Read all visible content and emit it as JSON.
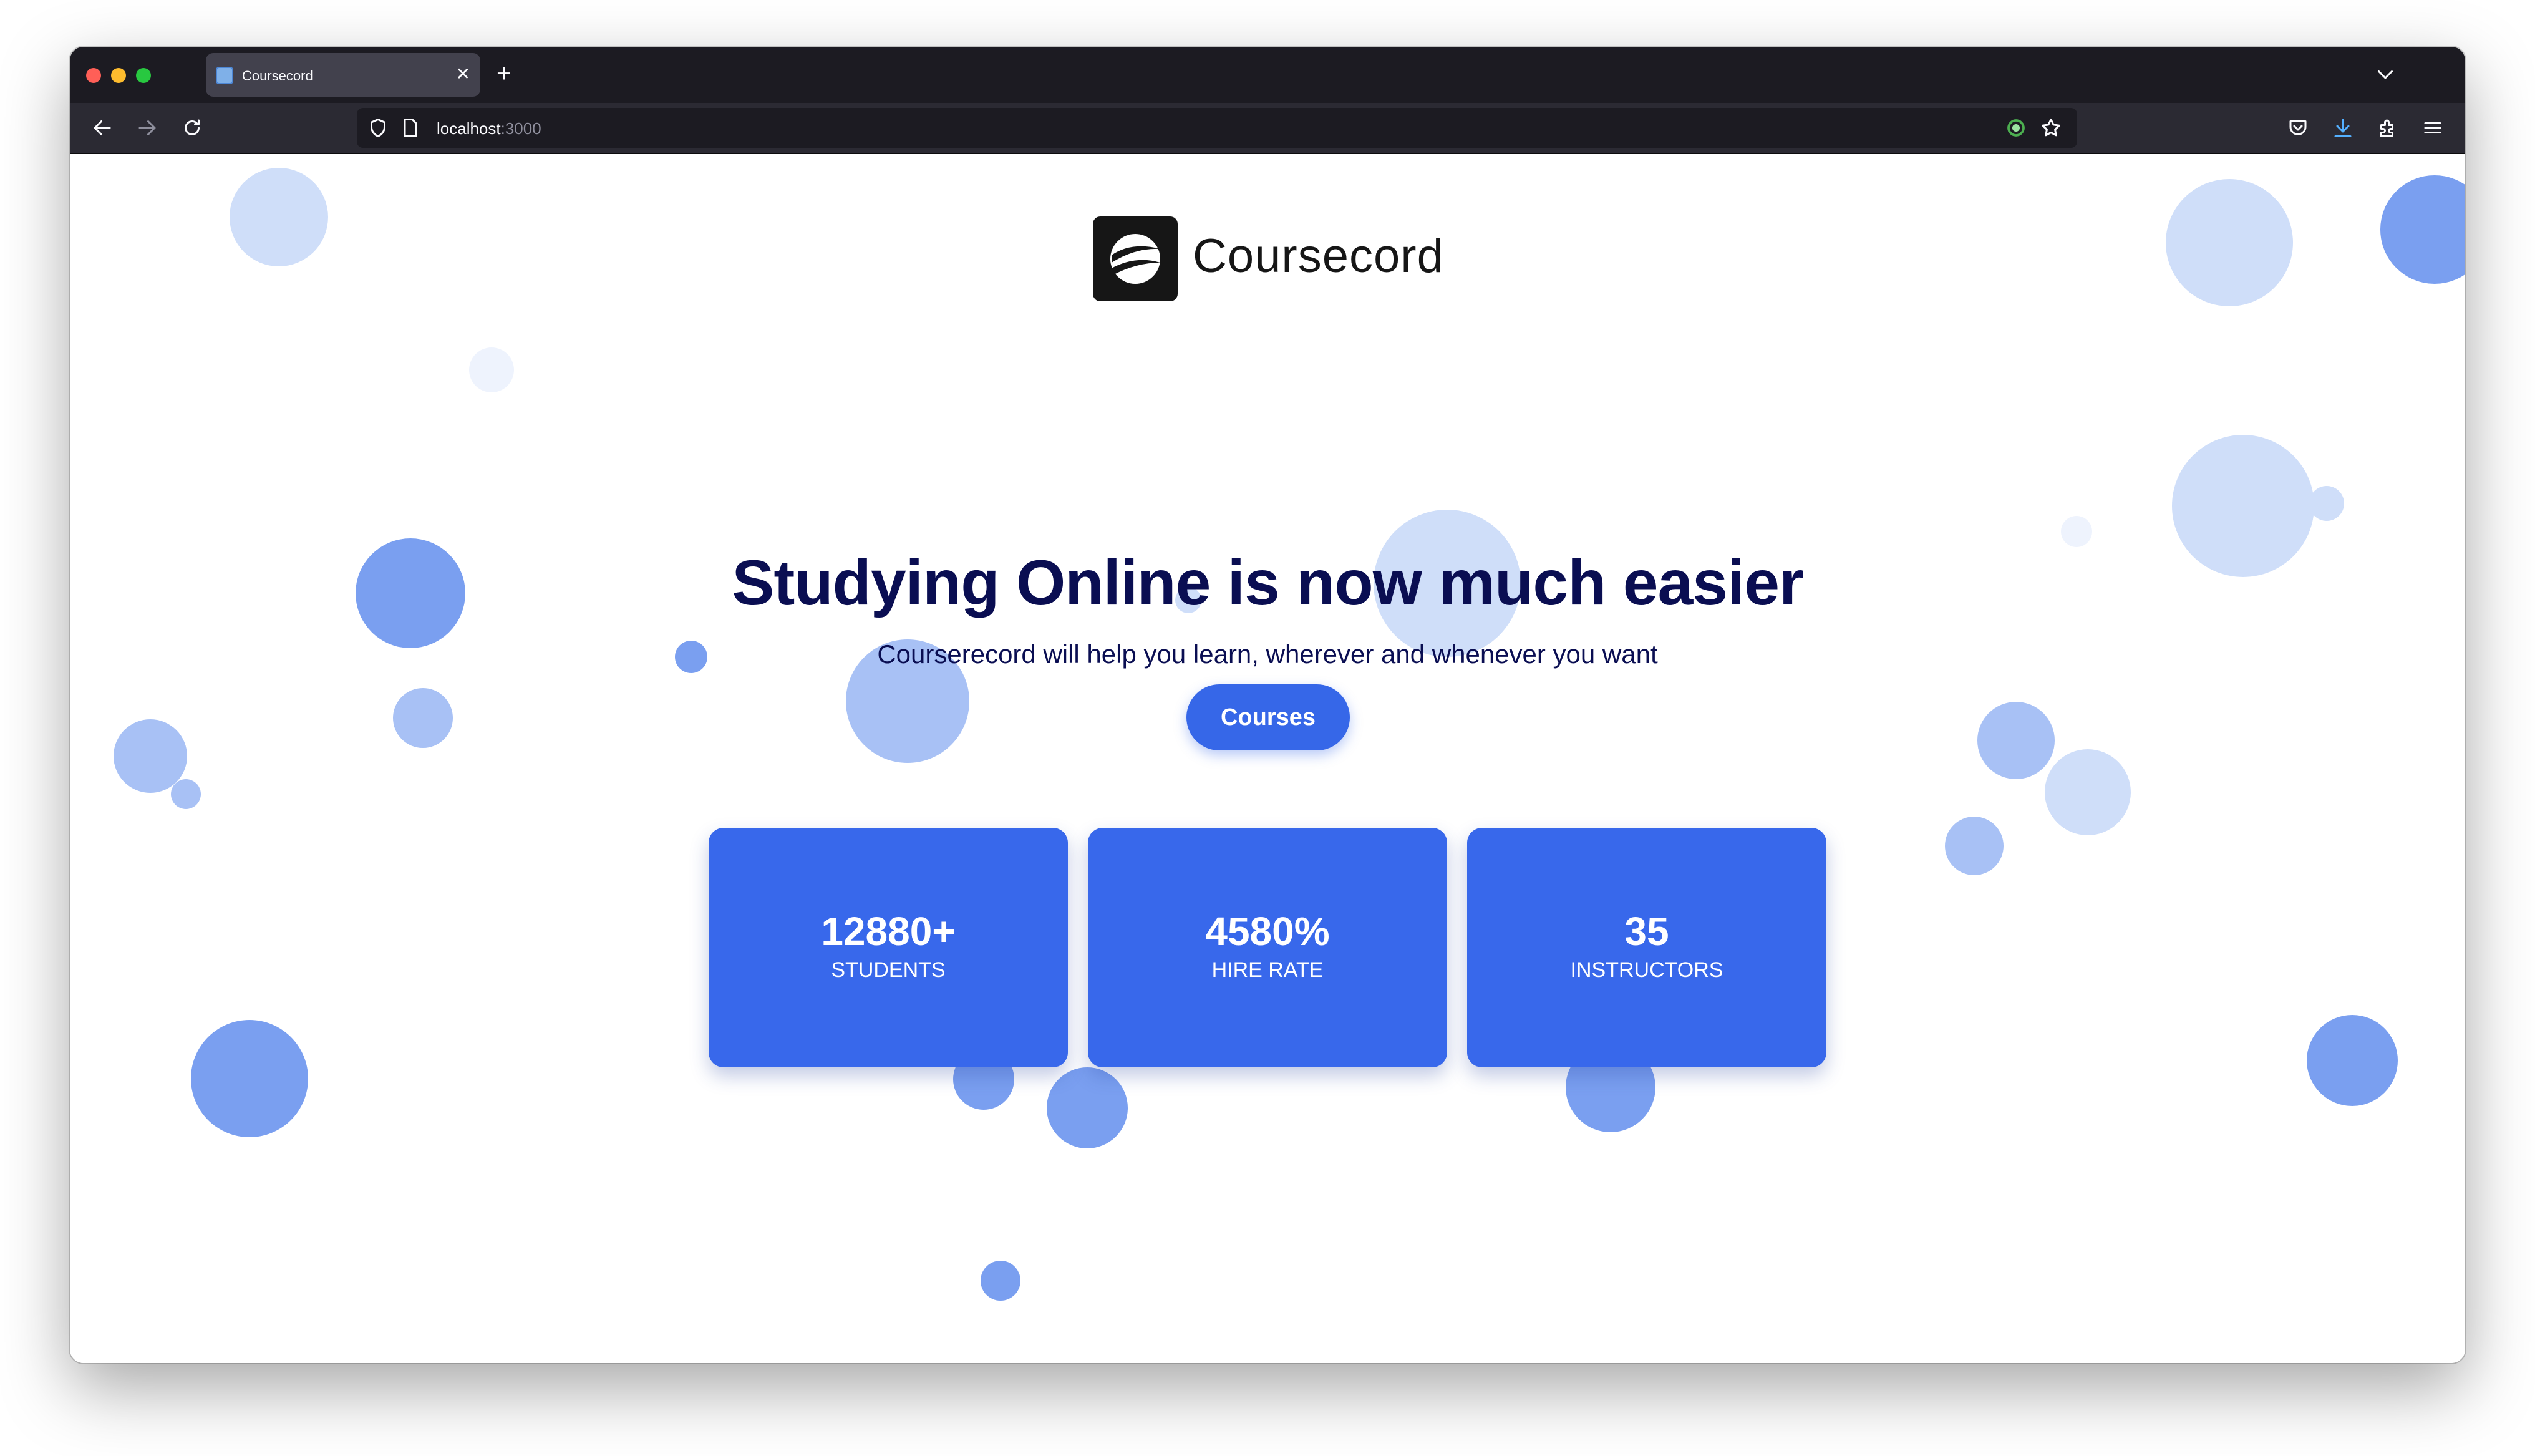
{
  "browser": {
    "tab": {
      "title": "Coursecord"
    },
    "url": {
      "host": "localhost",
      "port": ":3000"
    }
  },
  "site": {
    "brand": "Coursecord",
    "hero": {
      "title": "Studying Online is now much easier",
      "subtitle": "Courserecord will help you learn, wherever and whenever you want",
      "cta_label": "Courses"
    },
    "stats": [
      {
        "value": "12880+",
        "label": "STUDENTS"
      },
      {
        "value": "4580%",
        "label": "HIRE RATE"
      },
      {
        "value": "35",
        "label": "INSTRUCTORS"
      }
    ]
  },
  "colors": {
    "accent": "#3868eb",
    "heading": "#0a0e52",
    "browser_chrome": "#1c1b22"
  },
  "icons": [
    "back-arrow-icon",
    "forward-arrow-icon",
    "reload-icon",
    "shield-icon",
    "page-icon",
    "extension-badge-icon",
    "bookmark-star-icon",
    "pocket-icon",
    "download-icon",
    "extensions-icon",
    "menu-icon",
    "chevron-down-icon"
  ]
}
